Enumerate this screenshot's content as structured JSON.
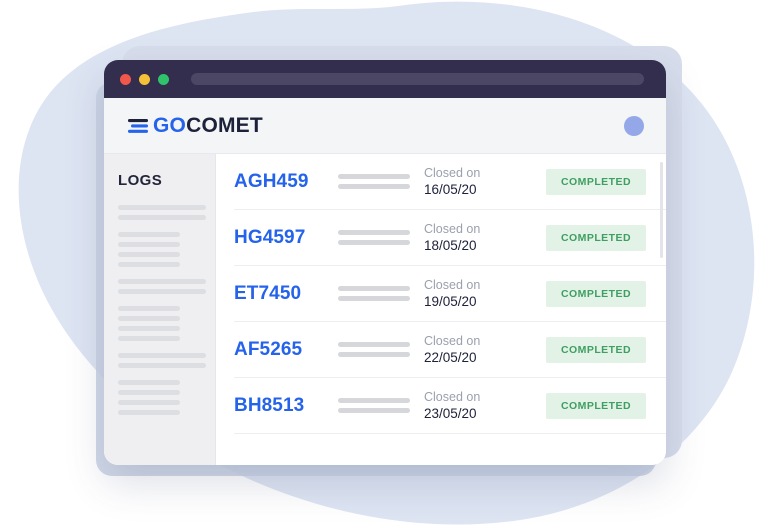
{
  "window": {
    "traffic_lights": [
      {
        "name": "close-dot",
        "color": "#f2574c"
      },
      {
        "name": "minimize-dot",
        "color": "#f5c237"
      },
      {
        "name": "maximize-dot",
        "color": "#2fc46b"
      }
    ],
    "address_value": ""
  },
  "header": {
    "logo_go": "GO",
    "logo_comet": "COMET",
    "brand_color": "#2563eb",
    "brand_dark": "#1d2139",
    "avatar_color": "#94a7e8"
  },
  "sidebar": {
    "title": "LOGS",
    "skeleton_groups": [
      {
        "wide": 2,
        "short": 0
      },
      {
        "wide": 0,
        "short": 4
      },
      {
        "wide": 2,
        "short": 0
      },
      {
        "wide": 0,
        "short": 4
      },
      {
        "wide": 2,
        "short": 0
      },
      {
        "wide": 0,
        "short": 4
      }
    ]
  },
  "list": {
    "date_label": "Closed on",
    "status_label": "COMPLETED",
    "status_bg": "#e2f2e6",
    "status_color": "#3f9e62",
    "rows": [
      {
        "id": "AGH459",
        "date_label": "Closed on",
        "date": "16/05/20",
        "status": "COMPLETED"
      },
      {
        "id": "HG4597",
        "date_label": "Closed on",
        "date": "18/05/20",
        "status": "COMPLETED"
      },
      {
        "id": "ET7450",
        "date_label": "Closed on",
        "date": "19/05/20",
        "status": "COMPLETED"
      },
      {
        "id": "AF5265",
        "date_label": "Closed on",
        "date": "22/05/20",
        "status": "COMPLETED"
      },
      {
        "id": "BH8513",
        "date_label": "Closed on",
        "date": "23/05/20",
        "status": "COMPLETED"
      }
    ]
  },
  "background": {
    "blob_color": "#dde4f2",
    "ghost_card_color": "#d7ddeb"
  }
}
